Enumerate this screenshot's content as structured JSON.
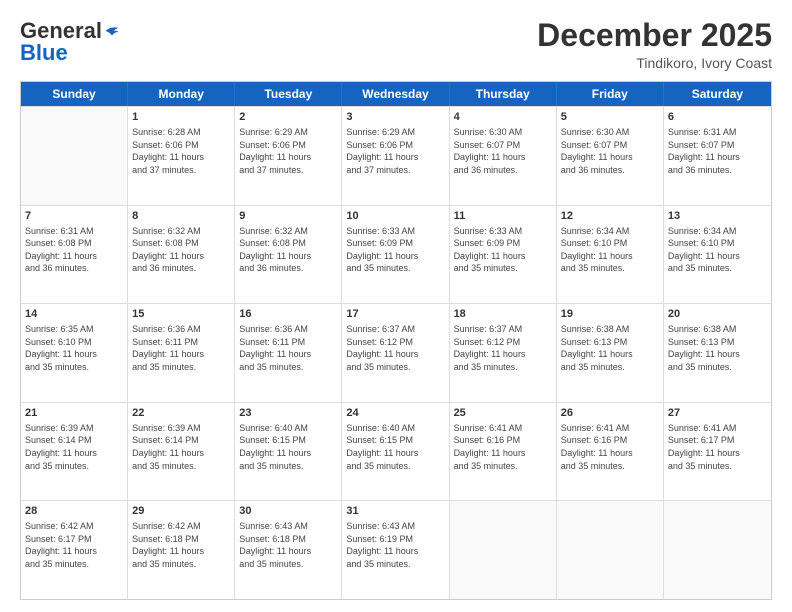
{
  "header": {
    "logo": {
      "line1": "General",
      "line2": "Blue"
    },
    "title": "December 2025",
    "location": "Tindikoro, Ivory Coast"
  },
  "weekdays": [
    "Sunday",
    "Monday",
    "Tuesday",
    "Wednesday",
    "Thursday",
    "Friday",
    "Saturday"
  ],
  "rows": [
    [
      {
        "day": "",
        "empty": true
      },
      {
        "day": "1",
        "sunrise": "Sunrise: 6:28 AM",
        "sunset": "Sunset: 6:06 PM",
        "daylight": "Daylight: 11 hours and 37 minutes."
      },
      {
        "day": "2",
        "sunrise": "Sunrise: 6:29 AM",
        "sunset": "Sunset: 6:06 PM",
        "daylight": "Daylight: 11 hours and 37 minutes."
      },
      {
        "day": "3",
        "sunrise": "Sunrise: 6:29 AM",
        "sunset": "Sunset: 6:06 PM",
        "daylight": "Daylight: 11 hours and 37 minutes."
      },
      {
        "day": "4",
        "sunrise": "Sunrise: 6:30 AM",
        "sunset": "Sunset: 6:07 PM",
        "daylight": "Daylight: 11 hours and 36 minutes."
      },
      {
        "day": "5",
        "sunrise": "Sunrise: 6:30 AM",
        "sunset": "Sunset: 6:07 PM",
        "daylight": "Daylight: 11 hours and 36 minutes."
      },
      {
        "day": "6",
        "sunrise": "Sunrise: 6:31 AM",
        "sunset": "Sunset: 6:07 PM",
        "daylight": "Daylight: 11 hours and 36 minutes."
      }
    ],
    [
      {
        "day": "7",
        "sunrise": "Sunrise: 6:31 AM",
        "sunset": "Sunset: 6:08 PM",
        "daylight": "Daylight: 11 hours and 36 minutes."
      },
      {
        "day": "8",
        "sunrise": "Sunrise: 6:32 AM",
        "sunset": "Sunset: 6:08 PM",
        "daylight": "Daylight: 11 hours and 36 minutes."
      },
      {
        "day": "9",
        "sunrise": "Sunrise: 6:32 AM",
        "sunset": "Sunset: 6:08 PM",
        "daylight": "Daylight: 11 hours and 36 minutes."
      },
      {
        "day": "10",
        "sunrise": "Sunrise: 6:33 AM",
        "sunset": "Sunset: 6:09 PM",
        "daylight": "Daylight: 11 hours and 35 minutes."
      },
      {
        "day": "11",
        "sunrise": "Sunrise: 6:33 AM",
        "sunset": "Sunset: 6:09 PM",
        "daylight": "Daylight: 11 hours and 35 minutes."
      },
      {
        "day": "12",
        "sunrise": "Sunrise: 6:34 AM",
        "sunset": "Sunset: 6:10 PM",
        "daylight": "Daylight: 11 hours and 35 minutes."
      },
      {
        "day": "13",
        "sunrise": "Sunrise: 6:34 AM",
        "sunset": "Sunset: 6:10 PM",
        "daylight": "Daylight: 11 hours and 35 minutes."
      }
    ],
    [
      {
        "day": "14",
        "sunrise": "Sunrise: 6:35 AM",
        "sunset": "Sunset: 6:10 PM",
        "daylight": "Daylight: 11 hours and 35 minutes."
      },
      {
        "day": "15",
        "sunrise": "Sunrise: 6:36 AM",
        "sunset": "Sunset: 6:11 PM",
        "daylight": "Daylight: 11 hours and 35 minutes."
      },
      {
        "day": "16",
        "sunrise": "Sunrise: 6:36 AM",
        "sunset": "Sunset: 6:11 PM",
        "daylight": "Daylight: 11 hours and 35 minutes."
      },
      {
        "day": "17",
        "sunrise": "Sunrise: 6:37 AM",
        "sunset": "Sunset: 6:12 PM",
        "daylight": "Daylight: 11 hours and 35 minutes."
      },
      {
        "day": "18",
        "sunrise": "Sunrise: 6:37 AM",
        "sunset": "Sunset: 6:12 PM",
        "daylight": "Daylight: 11 hours and 35 minutes."
      },
      {
        "day": "19",
        "sunrise": "Sunrise: 6:38 AM",
        "sunset": "Sunset: 6:13 PM",
        "daylight": "Daylight: 11 hours and 35 minutes."
      },
      {
        "day": "20",
        "sunrise": "Sunrise: 6:38 AM",
        "sunset": "Sunset: 6:13 PM",
        "daylight": "Daylight: 11 hours and 35 minutes."
      }
    ],
    [
      {
        "day": "21",
        "sunrise": "Sunrise: 6:39 AM",
        "sunset": "Sunset: 6:14 PM",
        "daylight": "Daylight: 11 hours and 35 minutes."
      },
      {
        "day": "22",
        "sunrise": "Sunrise: 6:39 AM",
        "sunset": "Sunset: 6:14 PM",
        "daylight": "Daylight: 11 hours and 35 minutes."
      },
      {
        "day": "23",
        "sunrise": "Sunrise: 6:40 AM",
        "sunset": "Sunset: 6:15 PM",
        "daylight": "Daylight: 11 hours and 35 minutes."
      },
      {
        "day": "24",
        "sunrise": "Sunrise: 6:40 AM",
        "sunset": "Sunset: 6:15 PM",
        "daylight": "Daylight: 11 hours and 35 minutes."
      },
      {
        "day": "25",
        "sunrise": "Sunrise: 6:41 AM",
        "sunset": "Sunset: 6:16 PM",
        "daylight": "Daylight: 11 hours and 35 minutes."
      },
      {
        "day": "26",
        "sunrise": "Sunrise: 6:41 AM",
        "sunset": "Sunset: 6:16 PM",
        "daylight": "Daylight: 11 hours and 35 minutes."
      },
      {
        "day": "27",
        "sunrise": "Sunrise: 6:41 AM",
        "sunset": "Sunset: 6:17 PM",
        "daylight": "Daylight: 11 hours and 35 minutes."
      }
    ],
    [
      {
        "day": "28",
        "sunrise": "Sunrise: 6:42 AM",
        "sunset": "Sunset: 6:17 PM",
        "daylight": "Daylight: 11 hours and 35 minutes."
      },
      {
        "day": "29",
        "sunrise": "Sunrise: 6:42 AM",
        "sunset": "Sunset: 6:18 PM",
        "daylight": "Daylight: 11 hours and 35 minutes."
      },
      {
        "day": "30",
        "sunrise": "Sunrise: 6:43 AM",
        "sunset": "Sunset: 6:18 PM",
        "daylight": "Daylight: 11 hours and 35 minutes."
      },
      {
        "day": "31",
        "sunrise": "Sunrise: 6:43 AM",
        "sunset": "Sunset: 6:19 PM",
        "daylight": "Daylight: 11 hours and 35 minutes."
      },
      {
        "day": "",
        "empty": true
      },
      {
        "day": "",
        "empty": true
      },
      {
        "day": "",
        "empty": true
      }
    ]
  ]
}
